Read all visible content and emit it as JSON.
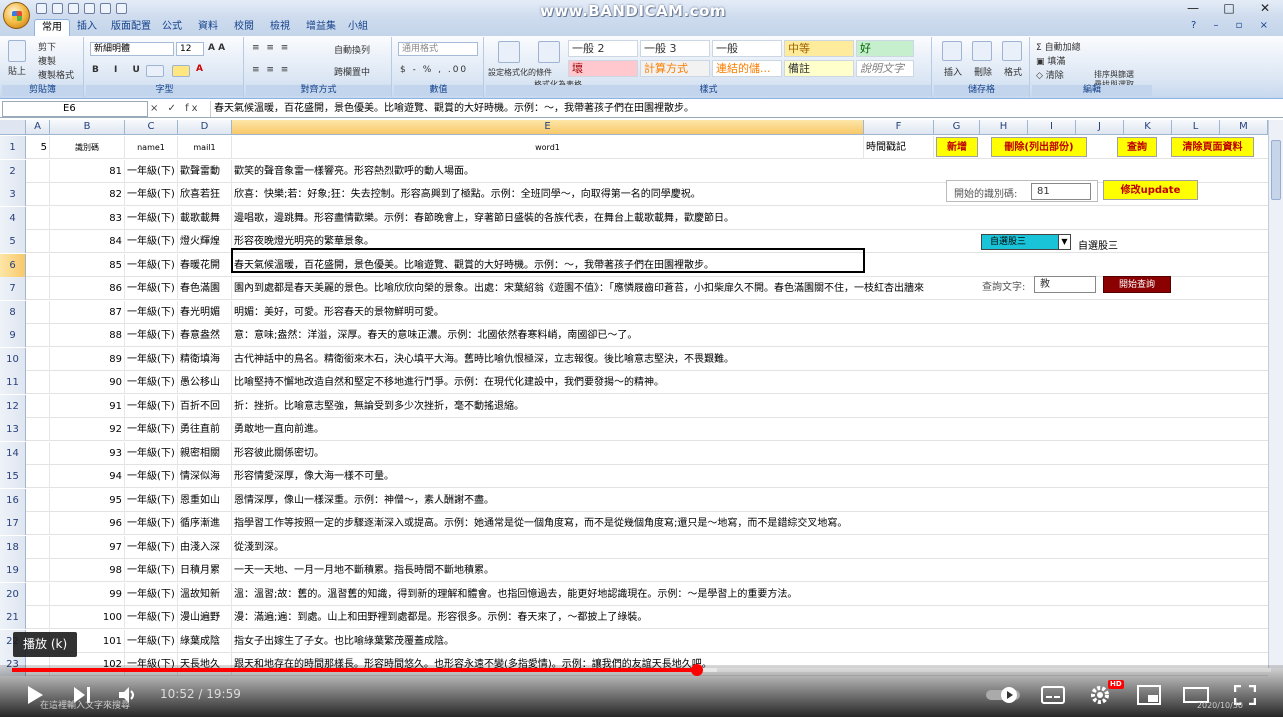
{
  "titlebar": {
    "watermark": "www.BANDICAM.com",
    "controls": [
      "—",
      "□",
      "✕"
    ]
  },
  "tabs": [
    "常用",
    "插入",
    "版面配置",
    "公式",
    "資料",
    "校閱",
    "檢視",
    "增益集",
    "小組"
  ],
  "ribbon": {
    "clipboard": {
      "label": "剪貼簿",
      "paste": "貼上",
      "cut": "剪下",
      "copy": "複製",
      "format_painter": "複製格式"
    },
    "font": {
      "label": "字型",
      "name": "新細明體",
      "size": "12"
    },
    "alignment": {
      "label": "對齊方式",
      "wrap": "自動換列",
      "merge": "跨欄置中"
    },
    "number": {
      "label": "數值",
      "format": "通用格式"
    },
    "styles": {
      "label": "樣式",
      "cells": [
        "一般 2",
        "一般 3",
        "一般",
        "中等",
        "好",
        "壞",
        "計算方式",
        "連結的儲...",
        "備註",
        "說明文字"
      ],
      "conditional": "設定格式化的條件",
      "as_table": "格式化為表格"
    },
    "cells_group": {
      "label": "儲存格",
      "insert": "插入",
      "delete": "刪除",
      "format": "格式"
    },
    "editing": {
      "label": "編輯",
      "autosum": "自動加總",
      "fill": "填滿",
      "clear": "清除",
      "sort": "排序與篩選",
      "find": "尋找與選取"
    }
  },
  "formula_bar": {
    "name_box": "E6",
    "fx": "× ✓ fx",
    "content": "春天氣候溫暖，百花盛開，景色優美。比喻遊覽、觀賞的大好時機。示例：～，我帶著孩子們在田園裡散步。"
  },
  "columns": [
    "A",
    "B",
    "C",
    "D",
    "E",
    "F",
    "G",
    "H",
    "I",
    "J",
    "K",
    "L",
    "M"
  ],
  "header_row": {
    "a": "5",
    "b": "識別碼",
    "c": "name1",
    "d": "mail1",
    "e": "word1",
    "f": "時間戳記"
  },
  "buttons": {
    "add": "新增",
    "delete": "刪除(列出部份)",
    "query": "查詢",
    "clear": "清除頁面資料",
    "update": "修改update",
    "start_query": "開始查詢"
  },
  "panel": {
    "start_id_label": "開始的識別碼:",
    "start_id_value": "81",
    "combo_value": "自選股三",
    "combo_label": "自選股三",
    "query_label": "查詢文字:",
    "query_value": "教"
  },
  "rows": [
    {
      "n": "2",
      "id": "81",
      "grade": "一年級(下)",
      "word": "歡聲雷動",
      "desc": "歡笑的聲音象雷一樣響亮。形容熱烈歡呼的動人場面。"
    },
    {
      "n": "3",
      "id": "82",
      "grade": "一年級(下)",
      "word": "欣喜若狂",
      "desc": "欣喜：快樂;若：好象;狂：失去控制。形容高興到了極點。示例：全班同學～，向取得第一名的同學慶祝。"
    },
    {
      "n": "4",
      "id": "83",
      "grade": "一年級(下)",
      "word": "載歌載舞",
      "desc": "邊唱歌，邊跳舞。形容盡情歡樂。示例：春節晚會上，穿著節日盛裝的各族代表，在舞台上載歌載舞，歡慶節日。"
    },
    {
      "n": "5",
      "id": "84",
      "grade": "一年級(下)",
      "word": "燈火輝煌",
      "desc": "形容夜晚燈光明亮的繁華景象。"
    },
    {
      "n": "6",
      "id": "85",
      "grade": "一年級(下)",
      "word": "春暖花開",
      "desc": "春天氣候溫暖，百花盛開，景色優美。比喻遊覽、觀賞的大好時機。示例：～，我帶著孩子們在田園裡散步。"
    },
    {
      "n": "7",
      "id": "86",
      "grade": "一年級(下)",
      "word": "春色滿園",
      "desc": "園內到處都是春天美麗的景色。比喻欣欣向榮的景象。出處：宋葉紹翁《遊園不值》：「應憐屐齒印蒼苔，小扣柴扉久不開。春色滿園關不住，一枝紅杏出牆來"
    },
    {
      "n": "8",
      "id": "87",
      "grade": "一年級(下)",
      "word": "春光明媚",
      "desc": "明媚：美好，可愛。形容春天的景物鮮明可愛。"
    },
    {
      "n": "9",
      "id": "88",
      "grade": "一年級(下)",
      "word": "春意盎然",
      "desc": "意：意味;盎然：洋溢，深厚。春天的意味正濃。示例：北國依然春寒料峭，南國卻已～了。"
    },
    {
      "n": "10",
      "id": "89",
      "grade": "一年級(下)",
      "word": "精衛填海",
      "desc": "古代神話中的鳥名。精衛銜來木石，決心填平大海。舊時比喻仇恨極深，立志報復。後比喻意志堅決，不畏艱難。"
    },
    {
      "n": "11",
      "id": "90",
      "grade": "一年級(下)",
      "word": "愚公移山",
      "desc": "比喻堅持不懈地改造自然和堅定不移地進行鬥爭。示例：在現代化建設中，我們要發揚～的精神。"
    },
    {
      "n": "12",
      "id": "91",
      "grade": "一年級(下)",
      "word": "百折不回",
      "desc": "折：挫折。比喻意志堅強，無論受到多少次挫折，毫不動搖退縮。"
    },
    {
      "n": "13",
      "id": "92",
      "grade": "一年級(下)",
      "word": "勇往直前",
      "desc": "勇敢地一直向前進。"
    },
    {
      "n": "14",
      "id": "93",
      "grade": "一年級(下)",
      "word": "親密相關",
      "desc": "形容彼此關係密切。"
    },
    {
      "n": "15",
      "id": "94",
      "grade": "一年級(下)",
      "word": "情深似海",
      "desc": "形容情愛深厚，像大海一樣不可量。"
    },
    {
      "n": "16",
      "id": "95",
      "grade": "一年級(下)",
      "word": "恩重如山",
      "desc": "恩情深厚，像山一樣深重。示例：神僧～，素人酬謝不盡。"
    },
    {
      "n": "17",
      "id": "96",
      "grade": "一年級(下)",
      "word": "循序漸進",
      "desc": "指學習工作等按照一定的步驟逐漸深入或提高。示例：她通常是從一個角度寫，而不是從幾個角度寫;還只是～地寫，而不是錯綜交叉地寫。"
    },
    {
      "n": "18",
      "id": "97",
      "grade": "一年級(下)",
      "word": "由淺入深",
      "desc": "從淺到深。"
    },
    {
      "n": "19",
      "id": "98",
      "grade": "一年級(下)",
      "word": "日積月累",
      "desc": "一天一天地、一月一月地不斷積累。指長時間不斷地積累。"
    },
    {
      "n": "20",
      "id": "99",
      "grade": "一年級(下)",
      "word": "溫故知新",
      "desc": "溫：溫習;故：舊的。溫習舊的知識，得到新的理解和體會。也指回憶過去，能更好地認識現在。示例：～是學習上的重要方法。"
    },
    {
      "n": "21",
      "id": "100",
      "grade": "一年級(下)",
      "word": "漫山遍野",
      "desc": "漫：滿遍;遍：到處。山上和田野裡到處都是。形容很多。示例：春天來了，～都披上了綠裝。"
    },
    {
      "n": "22",
      "id": "101",
      "grade": "一年級(下)",
      "word": "綠葉成陰",
      "desc": "指女子出嫁生了子女。也比喻綠葉繁茂覆蓋成陰。"
    },
    {
      "n": "23",
      "id": "102",
      "grade": "一年級(下)",
      "word": "天長地久",
      "desc": "跟天和地存在的時間那樣長。形容時間悠久。也形容永遠不變(多指愛情)。示例：讓我們的友誼天長地久吧。"
    }
  ],
  "player": {
    "tooltip": "播放 (k)",
    "time": "10:52 / 19:59",
    "progress": 0.544,
    "buffered": 0.56,
    "hd_badge": "HD",
    "taskbar_search": "在這裡輸入文字來搜尋",
    "clock": "2020/10/30"
  },
  "colors": {
    "button_yellow": "#ffff00",
    "button_text": "#c00000",
    "combo": "#19c4d9",
    "progress": "#ff0000"
  }
}
